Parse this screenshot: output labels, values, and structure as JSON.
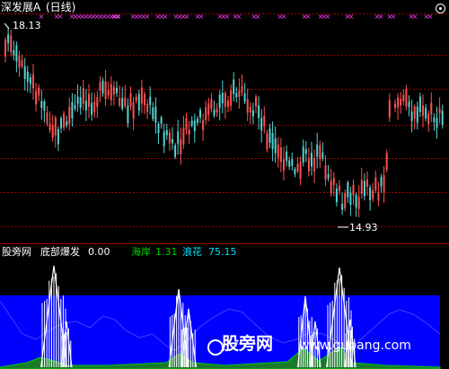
{
  "header": {
    "title": "深发展A",
    "period": "(日线)"
  },
  "price_panel": {
    "high_label": "18.13",
    "low_label": "14.93",
    "signal_glyph": "×"
  },
  "indicator_panel": {
    "source": "股旁网",
    "series": [
      {
        "name": "底部爆发",
        "value": "0.00",
        "color": "#ffffff"
      },
      {
        "name": "海岸",
        "value": "1.31",
        "color": "#00d000"
      },
      {
        "name": "浪花",
        "value": "75.15",
        "color": "#00e0ff"
      }
    ]
  },
  "watermark": {
    "brand": "股旁网",
    "url": "www.gupang.com"
  },
  "colors": {
    "up": "#ff5050",
    "down": "#54d2d2",
    "grid": "#a00000",
    "signal": "#ff40ff",
    "fill": "#0000ff",
    "curve": "#4040ff"
  },
  "chart_data": {
    "type": "candlestick",
    "price_high": 18.13,
    "price_low": 14.93,
    "indicator_value": 0.0,
    "haian_value": 1.31,
    "langhua_value": 75.15
  }
}
